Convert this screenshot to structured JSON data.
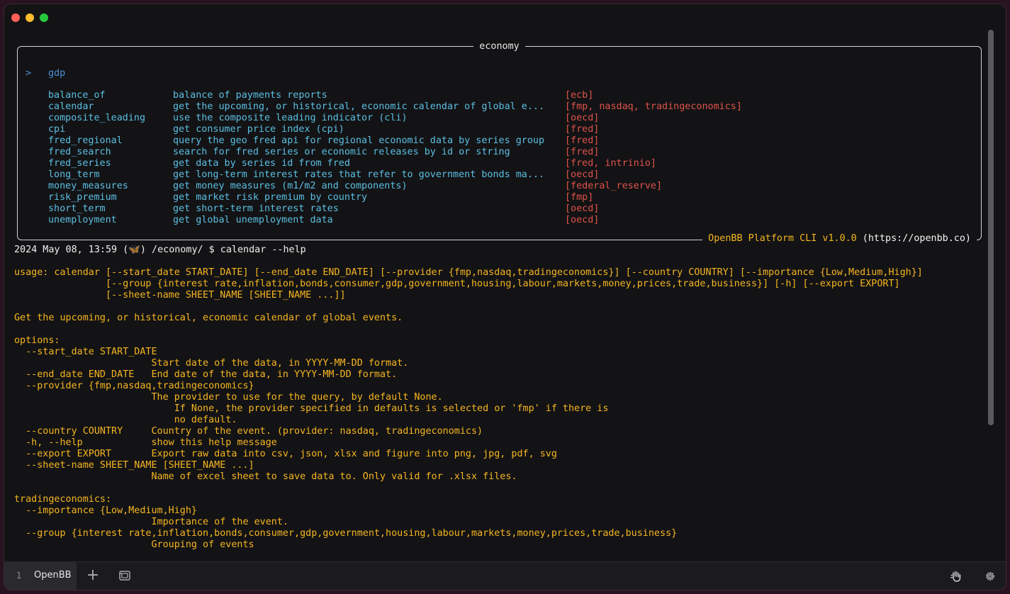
{
  "window": {
    "tab_number": "1",
    "tab_label": "OpenBB",
    "new_tab": "+"
  },
  "menu": {
    "title": "economy",
    "prompt_marker": ">",
    "prompt_item": "gdp",
    "commands": [
      {
        "name": "balance_of",
        "desc": "balance of payments reports",
        "providers": "[ecb]"
      },
      {
        "name": "calendar",
        "desc": "get the upcoming, or historical, economic calendar of global e...",
        "providers": "[fmp, nasdaq, tradingeconomics]"
      },
      {
        "name": "composite_leading",
        "desc": "use the composite leading indicator (cli)",
        "providers": "[oecd]"
      },
      {
        "name": "cpi",
        "desc": "get consumer price index (cpi)",
        "providers": "[fred]"
      },
      {
        "name": "fred_regional",
        "desc": "query the geo fred api for regional economic data by series group",
        "providers": "[fred]"
      },
      {
        "name": "fred_search",
        "desc": "search for fred series or economic releases by id or string",
        "providers": "[fred]"
      },
      {
        "name": "fred_series",
        "desc": "get data by series id from fred",
        "providers": "[fred, intrinio]"
      },
      {
        "name": "long_term",
        "desc": "get long-term interest rates that refer to government bonds ma...",
        "providers": "[oecd]"
      },
      {
        "name": "money_measures",
        "desc": "get money measures (m1/m2 and components)",
        "providers": "[federal_reserve]"
      },
      {
        "name": "risk_premium",
        "desc": "get market risk premium by country",
        "providers": "[fmp]"
      },
      {
        "name": "short_term",
        "desc": "get short-term interest rates",
        "providers": "[oecd]"
      },
      {
        "name": "unemployment",
        "desc": "get global unemployment data",
        "providers": "[oecd]"
      }
    ],
    "footer_brand": "OpenBB Platform CLI v1.0.0",
    "footer_url": " (https://openbb.co)"
  },
  "prompt_line": "2024 May 08, 13:59 (🦋) /economy/ $ calendar --help",
  "help": {
    "usage": [
      "usage: calendar [--start_date START_DATE] [--end_date END_DATE] [--provider {fmp,nasdaq,tradingeconomics}] [--country COUNTRY] [--importance {Low,Medium,High}]",
      "                [--group {interest rate,inflation,bonds,consumer,gdp,government,housing,labour,markets,money,prices,trade,business}] [-h] [--export EXPORT]",
      "                [--sheet-name SHEET_NAME [SHEET_NAME ...]]"
    ],
    "description": "Get the upcoming, or historical, economic calendar of global events.",
    "options_header": "options:",
    "options": [
      "  --start_date START_DATE",
      "                        Start date of the data, in YYYY-MM-DD format.",
      "  --end_date END_DATE   End date of the data, in YYYY-MM-DD format.",
      "  --provider {fmp,nasdaq,tradingeconomics}",
      "                        The provider to use for the query, by default None.",
      "                            If None, the provider specified in defaults is selected or 'fmp' if there is",
      "                            no default.",
      "  --country COUNTRY     Country of the event. (provider: nasdaq, tradingeconomics)",
      "  -h, --help            show this help message",
      "  --export EXPORT       Export raw data into csv, json, xlsx and figure into png, jpg, pdf, svg",
      "  --sheet-name SHEET_NAME [SHEET_NAME ...]",
      "                        Name of excel sheet to save data to. Only valid for .xlsx files."
    ],
    "te_header": "tradingeconomics:",
    "te_options": [
      "  --importance {Low,Medium,High}",
      "                        Importance of the event.",
      "  --group {interest rate,inflation,bonds,consumer,gdp,government,housing,labour,markets,money,prices,trade,business}",
      "                        Grouping of events"
    ]
  },
  "colors": {
    "accent": "#f6b521",
    "command": "#5cbfe3",
    "provider": "#e0524a",
    "prompt": "#4a8fd9"
  }
}
